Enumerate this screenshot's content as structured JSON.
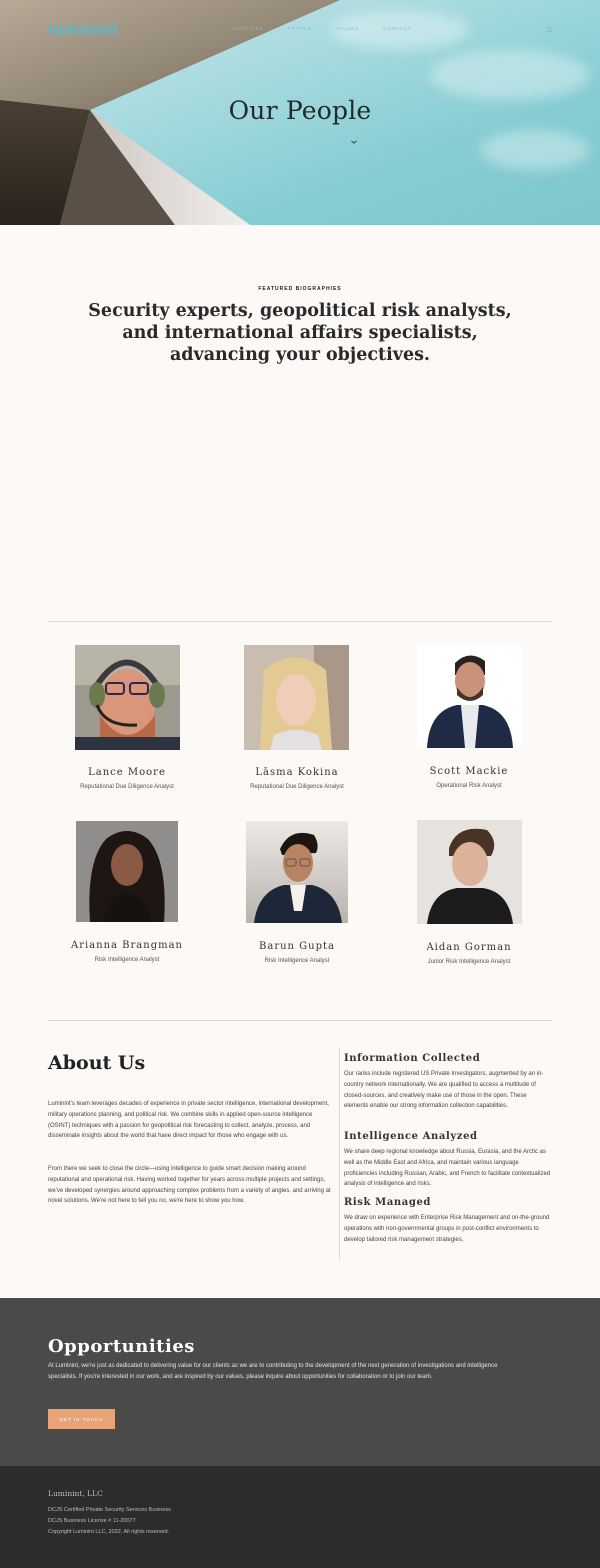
{
  "header": {
    "logo": "luminint",
    "nav": [
      "Services",
      "People",
      "Values",
      "Contact"
    ]
  },
  "hero": {
    "title": "Our People"
  },
  "intro": {
    "eyebrow": "FEATURED BIOGRAPHIES",
    "heading": "Security experts, geopolitical risk analysts, and international affairs specialists, advancing your objectives."
  },
  "team": [
    {
      "name": "Lance Moore",
      "role": "Reputational Due Diligence Analyst"
    },
    {
      "name": "Lāsma Kokina",
      "role": "Reputational Due Diligence Analyst"
    },
    {
      "name": "Scott Mackie",
      "role": "Operational Risk Analyst"
    },
    {
      "name": "Arianna Brangman",
      "role": "Risk Intelligence Analyst"
    },
    {
      "name": "Barun Gupta",
      "role": "Risk Intelligence Analyst"
    },
    {
      "name": "Aidan Gorman",
      "role": "Junior Risk Intelligence Analyst"
    }
  ],
  "about": {
    "title": "About Us",
    "p1": "Luminint's team leverages decades of experience in private sector intelligence, international development, military operations planning, and political risk. We combine skills in applied open-source intelligence (OSINT) techniques with a passion for geopolitical risk forecasting to collect, analyze, process, and disseminate insights about the world that have direct impact for those who engage with us.",
    "p2": "From there we seek to close the circle—using intelligence to guide smart decision making around reputational and operational risk. Having worked together for years across multiple projects and settings, we've developed synergies around approaching complex problems from a variety of angles, and arriving at novel solutions. We're not here to tell you no, we're here to show you how."
  },
  "info": [
    {
      "heading": "Information Collected",
      "text": "Our ranks include registered US Private Investigators, augmented by an in-country network internationally. We are qualified to access a multitude of closed-sources, and creatively make use of those in the open. These elements enable our strong information collection capabilities."
    },
    {
      "heading": "Intelligence Analyzed",
      "text": "We share deep regional knowledge about Russia, Eurasia, and the Arctic as well as the Middle East and Africa, and maintain various language proficiencies including Russian, Arabic, and French to facilitate contextualized analysis of intelligence and risks."
    },
    {
      "heading": "Risk Managed",
      "text": "We draw on experience with Enterprise Risk Management and on-the-ground operations with non-governmental groups in post-conflict environments to develop tailored risk management strategies."
    }
  ],
  "opportunities": {
    "title": "Opportunities",
    "text": "At Luminint, we're just as dedicated to delivering value for our clients as we are to contributing to the development of the next generation of investigations and intelligence specialists. If you're interested in our work, and are inspired by our values, please inquire about opportunities for collaboration or to join our team.",
    "cta": "Get in touch"
  },
  "footer": {
    "brand": "Luminint, LLC",
    "line1": "DCJS Certified Private Security Services Business",
    "line2": "DCJS Business License # 11-20077",
    "line3": "Copyright Luminint LLC, 2022.  All rights reserved."
  },
  "colors": {
    "accent": "#5fb6c6",
    "cta": "#e8a477",
    "opportunities_bg": "#4a4a4a",
    "footer_bg": "#2c2c2c"
  }
}
